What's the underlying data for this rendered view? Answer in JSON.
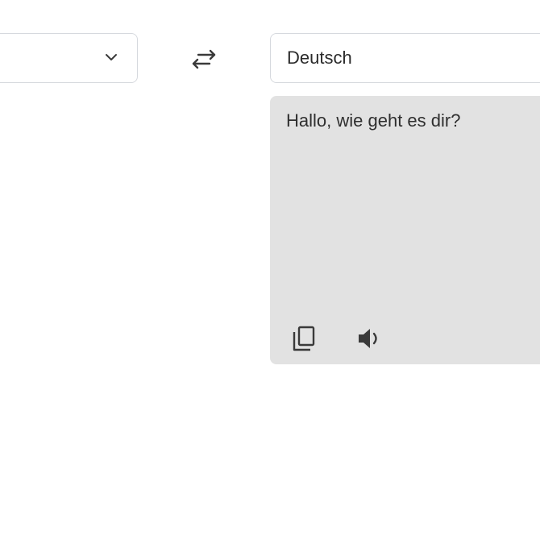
{
  "source_language": {
    "selected": ""
  },
  "target_language": {
    "selected": "Deutsch"
  },
  "translation": {
    "output_text": "Hallo, wie geht es dir?"
  },
  "icons": {
    "source_dropdown": "chevron-down-icon",
    "swap": "swap-arrows-icon",
    "copy": "copy-icon",
    "speak": "speaker-icon"
  },
  "colors": {
    "output_background": "#e2e2e2",
    "border": "#d6d9de",
    "text": "#2f2f2f",
    "icon": "#3a3a3a"
  }
}
